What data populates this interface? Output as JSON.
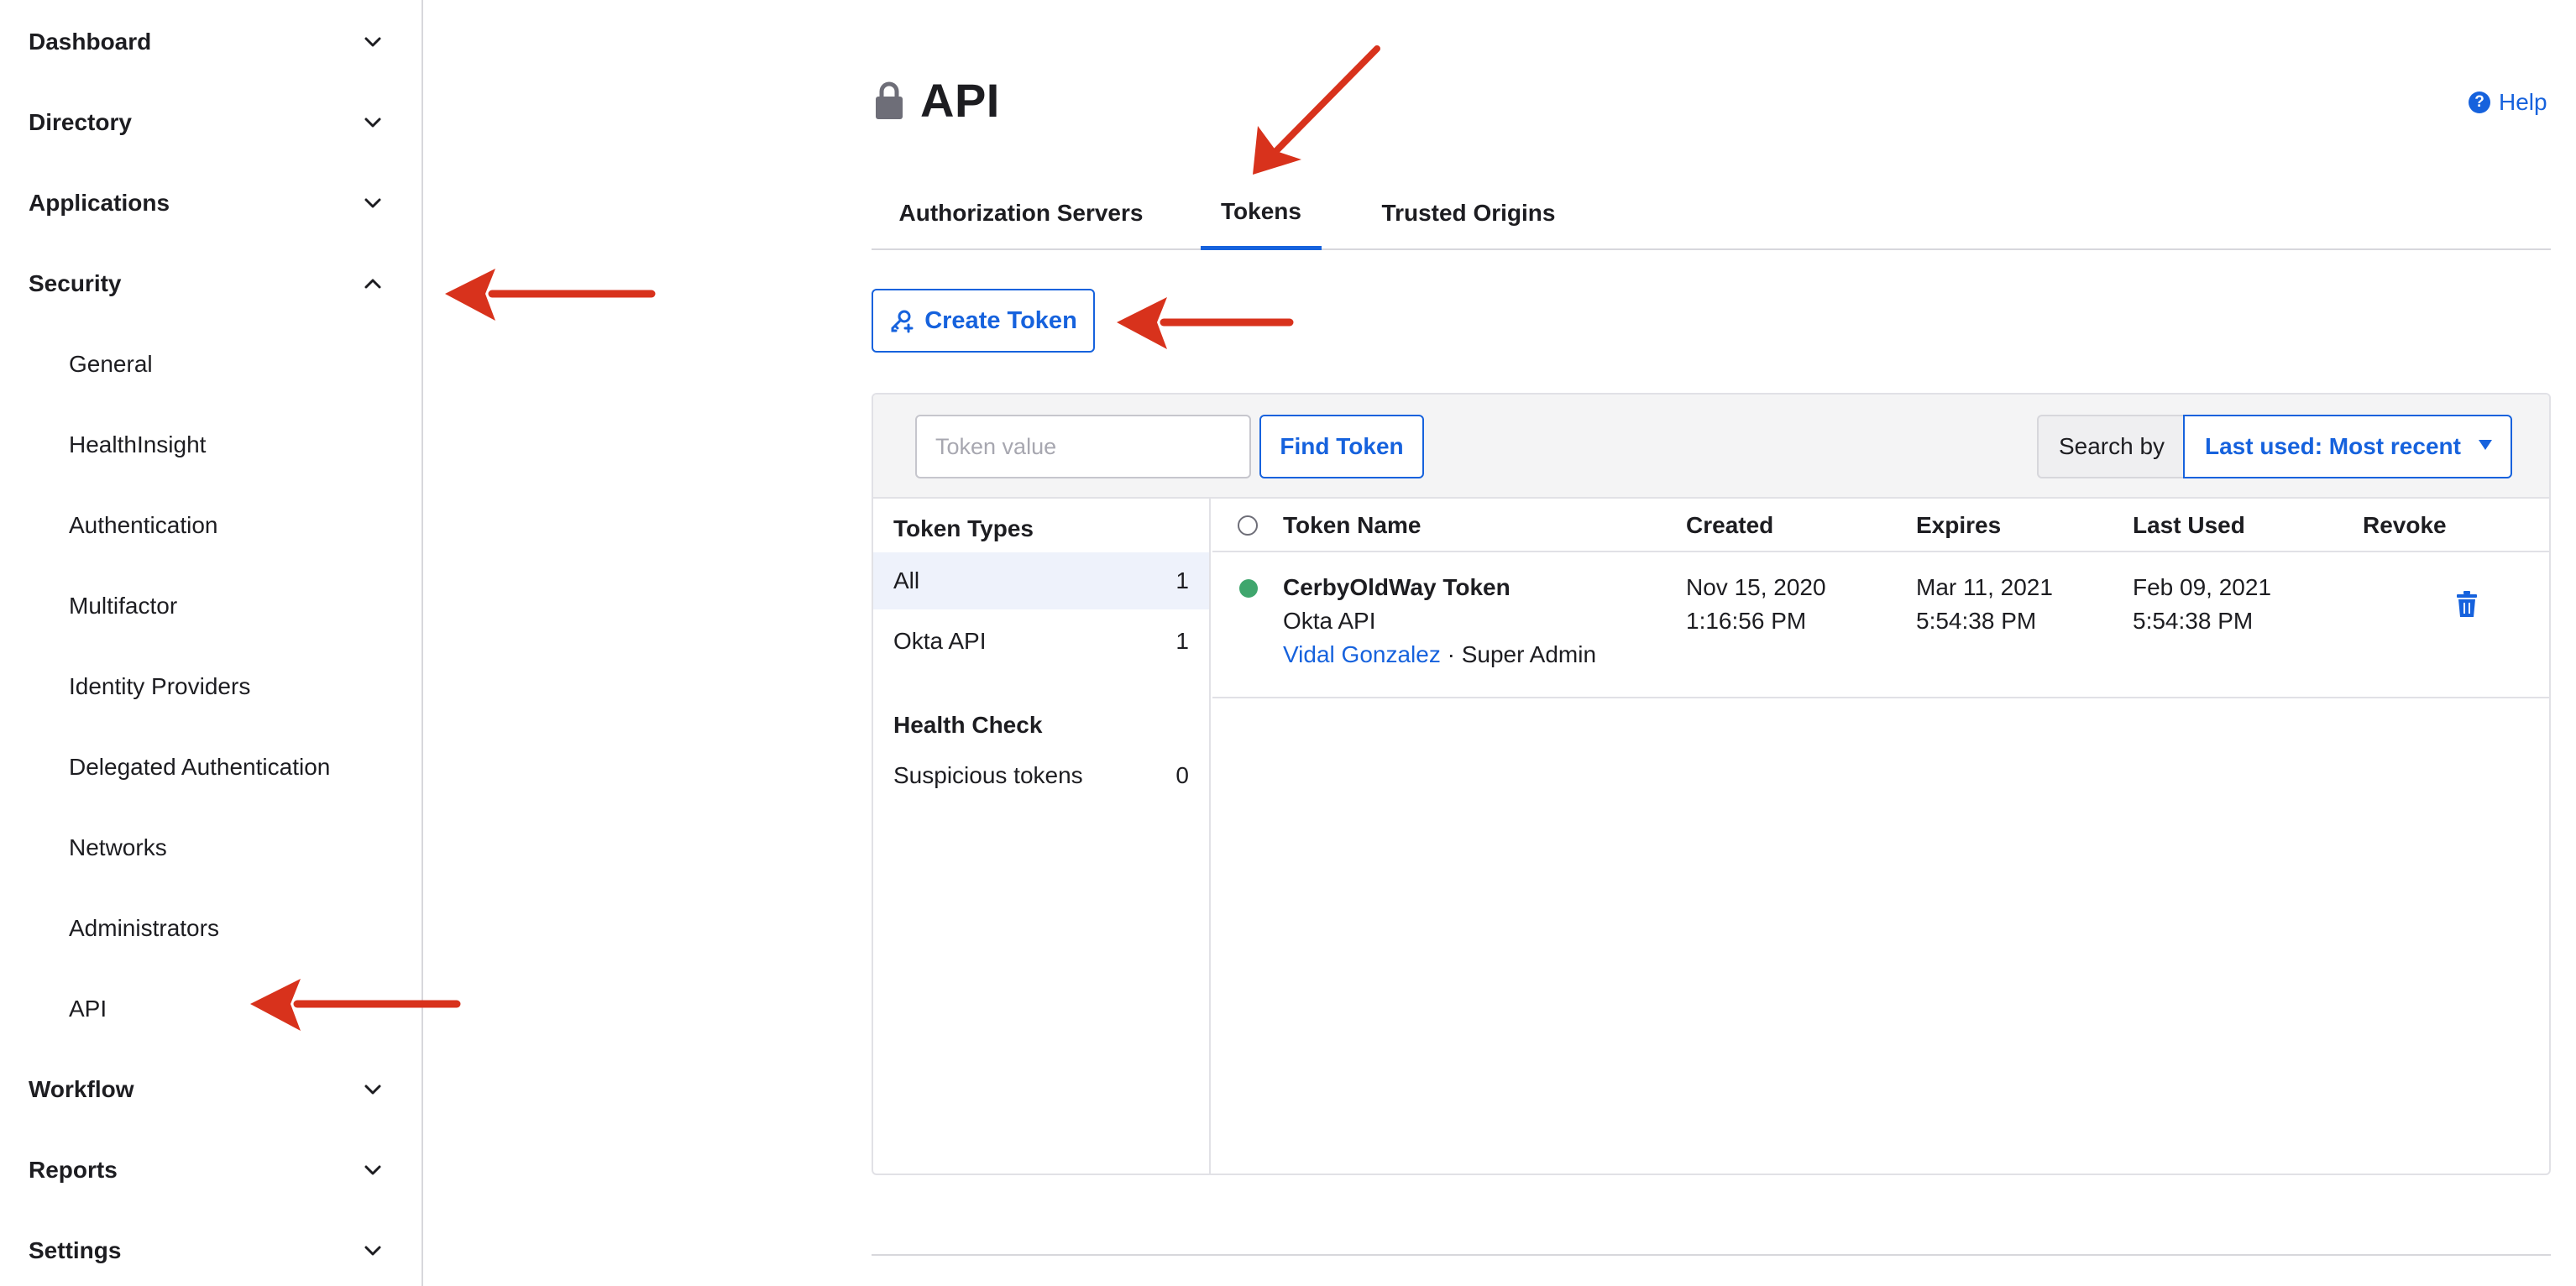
{
  "sidebar": {
    "items": [
      {
        "label": "Dashboard",
        "expanded": false
      },
      {
        "label": "Directory",
        "expanded": false
      },
      {
        "label": "Applications",
        "expanded": false
      },
      {
        "label": "Security",
        "expanded": true
      },
      {
        "label": "Workflow",
        "expanded": false
      },
      {
        "label": "Reports",
        "expanded": false
      },
      {
        "label": "Settings",
        "expanded": false
      }
    ],
    "security_subitems": [
      "General",
      "HealthInsight",
      "Authentication",
      "Multifactor",
      "Identity Providers",
      "Delegated Authentication",
      "Networks",
      "Administrators",
      "API"
    ]
  },
  "header": {
    "title": "API",
    "help_label": "Help",
    "help_icon_glyph": "?"
  },
  "tabs": [
    {
      "label": "Authorization Servers",
      "active": false
    },
    {
      "label": "Tokens",
      "active": true
    },
    {
      "label": "Trusted Origins",
      "active": false
    }
  ],
  "actions": {
    "create_token_label": "Create Token"
  },
  "toolbar": {
    "token_placeholder": "Token value",
    "find_label": "Find Token",
    "search_by_label": "Search by",
    "sort_selected": "Last used: Most recent"
  },
  "token_types": {
    "header": "Token Types",
    "items": [
      {
        "label": "All",
        "count": "1",
        "selected": true
      },
      {
        "label": "Okta API",
        "count": "1",
        "selected": false
      }
    ],
    "health_header": "Health Check",
    "health_items": [
      {
        "label": "Suspicious tokens",
        "count": "0"
      }
    ]
  },
  "table": {
    "columns": [
      "Token Name",
      "Created",
      "Expires",
      "Last Used",
      "Revoke"
    ],
    "rows": [
      {
        "status": "active",
        "name": "CerbyOldWay Token",
        "type": "Okta API",
        "owner": "Vidal Gonzalez",
        "separator": " · ",
        "role": "Super Admin",
        "created_date": "Nov 15, 2020",
        "created_time": "1:16:56 PM",
        "expires_date": "Mar 11, 2021",
        "expires_time": "5:54:38 PM",
        "last_used_date": "Feb 09, 2021",
        "last_used_time": "5:54:38 PM"
      }
    ]
  },
  "colors": {
    "accent": "#1662dd",
    "status_active": "#3fa66d",
    "annotation_arrow": "#d8321c"
  }
}
